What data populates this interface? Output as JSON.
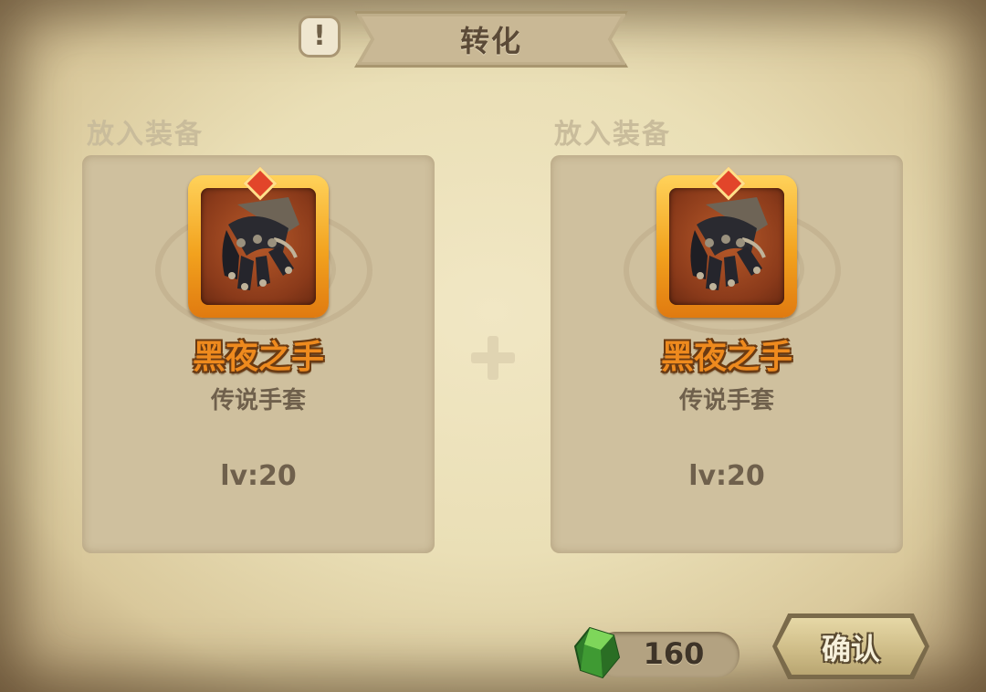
{
  "header": {
    "title": "转化",
    "info_icon": "exclamation-icon"
  },
  "slots": [
    {
      "label": "放入装备",
      "item": {
        "name": "黑夜之手",
        "type": "传说手套",
        "level": "lv:20",
        "icon": "black-gauntlet-icon",
        "rarity_color": "#f2a21e"
      }
    },
    {
      "label": "放入装备",
      "item": {
        "name": "黑夜之手",
        "type": "传说手套",
        "level": "lv:20",
        "icon": "black-gauntlet-icon",
        "rarity_color": "#f2a21e"
      }
    }
  ],
  "combine_icon": "plus-icon",
  "cost": {
    "icon": "green-crystal-icon",
    "value": "160",
    "color": "#4caf3a"
  },
  "confirm": {
    "label": "确认"
  }
}
